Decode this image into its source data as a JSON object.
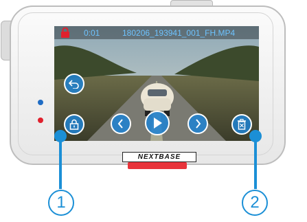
{
  "device": {
    "brand": "NEXTBASE"
  },
  "screen": {
    "time": "0:01",
    "filename": "180206_193941_001_FH.MP4"
  },
  "controls": [
    "back-icon",
    "protect-icon",
    "previous-icon",
    "play-icon",
    "next-icon",
    "delete-icon"
  ],
  "callouts": {
    "one": "1",
    "two": "2"
  },
  "colors": {
    "accent": "#1b8fd6",
    "lock": "#e0202d",
    "text": "#6ec3ff"
  }
}
